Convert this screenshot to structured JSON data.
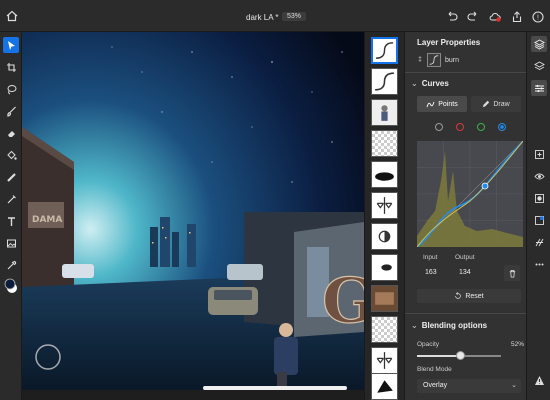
{
  "header": {
    "document_title": "dark LA *",
    "zoom": "53%",
    "icons": [
      "home-icon",
      "undo-icon",
      "redo-icon",
      "cloud-icon",
      "share-icon",
      "help-icon"
    ]
  },
  "left_tools": [
    "select-tool-icon",
    "crop-tool-icon",
    "lasso-tool-icon",
    "brush-tool-icon",
    "eraser-tool-icon",
    "fill-tool-icon",
    "healing-tool-icon",
    "refine-tool-icon",
    "type-tool-icon",
    "image-tool-icon",
    "eyedropper-tool-icon",
    "color-swatch"
  ],
  "properties": {
    "title": "Layer Properties",
    "layer_name": "burn",
    "curves": {
      "section_title": "Curves",
      "points_label": "Points",
      "draw_label": "Draw",
      "channel_colors": [
        "#9a9a9a",
        "#d43a3a",
        "#3cb34a",
        "#1f8df2"
      ],
      "input_label": "Input",
      "output_label": "Output",
      "input_value": "163",
      "output_value": "134",
      "reset_label": "Reset"
    },
    "blending": {
      "section_title": "Blending options",
      "opacity_label": "Opacity",
      "opacity_value": "52%",
      "opacity_fraction": 0.52,
      "blend_mode_label": "Blend Mode",
      "blend_mode_value": "Overlay"
    }
  },
  "right_tools": [
    "layers-icon",
    "layer-stack-icon",
    "adjustments-icon",
    "add-layer-icon",
    "visibility-icon",
    "mask-icon",
    "layer-properties-icon",
    "fx-icon",
    "more-icon",
    "warning-icon"
  ],
  "colors": {
    "accent": "#1473e6",
    "panel_bg": "#323232",
    "toolbar_bg": "#2b2b2b"
  }
}
